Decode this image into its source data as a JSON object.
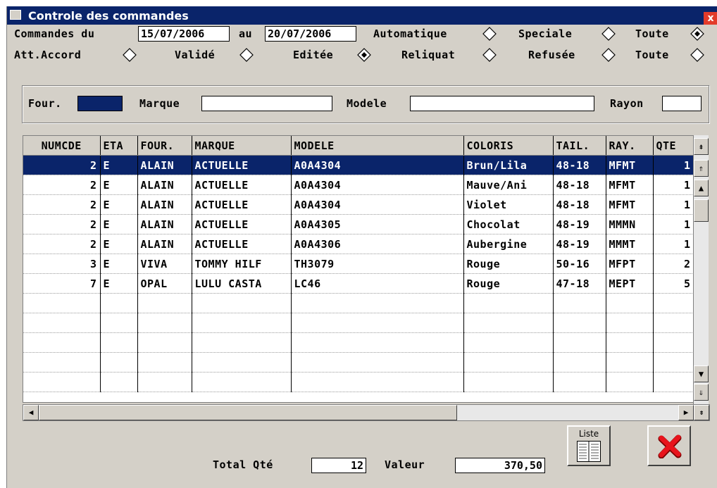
{
  "window": {
    "title": "Controle des commandes",
    "close_glyph": "x"
  },
  "filters": {
    "commandes_du_label": "Commandes du",
    "date_from": "15/07/2006",
    "au_label": "au",
    "date_to": "20/07/2006",
    "type_options": [
      {
        "label": "Automatique",
        "checked": false
      },
      {
        "label": "Speciale",
        "checked": false
      },
      {
        "label": "Toute",
        "checked": true
      }
    ],
    "status_options": [
      {
        "label": "Att.Accord",
        "checked": false
      },
      {
        "label": "Validé",
        "checked": false
      },
      {
        "label": "Editée",
        "checked": true
      },
      {
        "label": "Reliquat",
        "checked": false
      },
      {
        "label": "Refusée",
        "checked": false
      },
      {
        "label": "Toute",
        "checked": false
      }
    ]
  },
  "search": {
    "four_label": "Four.",
    "four_value": "",
    "marque_label": "Marque",
    "marque_value": "",
    "modele_label": "Modele",
    "modele_value": "",
    "rayon_label": "Rayon",
    "rayon_value": ""
  },
  "table": {
    "columns": [
      "NUMCDE",
      "ETA",
      "FOUR.",
      "MARQUE",
      "MODELE",
      "COLORIS",
      "TAIL.",
      "RAY.",
      "QTE"
    ],
    "rows": [
      [
        "2",
        "E",
        "ALAIN",
        "ACTUELLE",
        "A0A4304",
        "Brun/Lila",
        "48-18",
        "MFMT",
        "1"
      ],
      [
        "2",
        "E",
        "ALAIN",
        "ACTUELLE",
        "A0A4304",
        "Mauve/Ani",
        "48-18",
        "MFMT",
        "1"
      ],
      [
        "2",
        "E",
        "ALAIN",
        "ACTUELLE",
        "A0A4304",
        "Violet",
        "48-18",
        "MFMT",
        "1"
      ],
      [
        "2",
        "E",
        "ALAIN",
        "ACTUELLE",
        "A0A4305",
        "Chocolat",
        "48-19",
        "MMMN",
        "1"
      ],
      [
        "2",
        "E",
        "ALAIN",
        "ACTUELLE",
        "A0A4306",
        "Aubergine",
        "48-19",
        "MMMT",
        "1"
      ],
      [
        "3",
        "E",
        "VIVA",
        "TOMMY HILF",
        "TH3079",
        "Rouge",
        "50-16",
        "MFPT",
        "2"
      ],
      [
        "7",
        "E",
        "OPAL",
        "LULU CASTA",
        "LC46",
        "Rouge",
        "47-18",
        "MEPT",
        "5"
      ]
    ],
    "empty_rows": 5,
    "selected_row": 0
  },
  "totals": {
    "qte_label": "Total Qté",
    "qte_value": "12",
    "valeur_label": "Valeur",
    "valeur_value": "370,50"
  },
  "buttons": {
    "liste_label": "Liste",
    "cancel_icon": "red-x-icon"
  },
  "colors": {
    "titlebar": "#0a246a",
    "face": "#d4d0c8",
    "selection": "#0a246a",
    "cancel": "#e8141c"
  }
}
